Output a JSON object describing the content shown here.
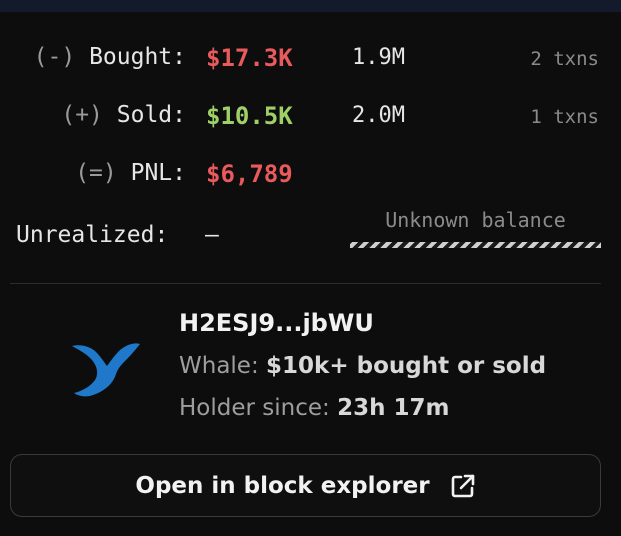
{
  "stats": {
    "bought": {
      "sign": "(-)",
      "label": "Bought:",
      "amount": "$17.3K",
      "tokens": "1.9M",
      "txns": "2 txns"
    },
    "sold": {
      "sign": "(+)",
      "label": "Sold:",
      "amount": "$10.5K",
      "tokens": "2.0M",
      "txns": "1 txns"
    },
    "pnl": {
      "sign": "(=)",
      "label": "PNL:",
      "amount": "$6,789"
    },
    "unrealized": {
      "label": "Unrealized:",
      "value": "—",
      "note": "Unknown balance"
    }
  },
  "holder": {
    "icon": "whale-icon",
    "wallet": "H2ESJ9...jbWU",
    "tier_label": "Whale:",
    "tier_value": "$10k+ bought or sold",
    "since_label": "Holder since:",
    "since_value": "23h 17m"
  },
  "explorer": {
    "label": "Open in block explorer",
    "icon": "external-link-icon"
  },
  "colors": {
    "negative": "#e85a5c",
    "positive": "#9fd068",
    "whale": "#1f78c9",
    "background": "#0d0d0e"
  }
}
